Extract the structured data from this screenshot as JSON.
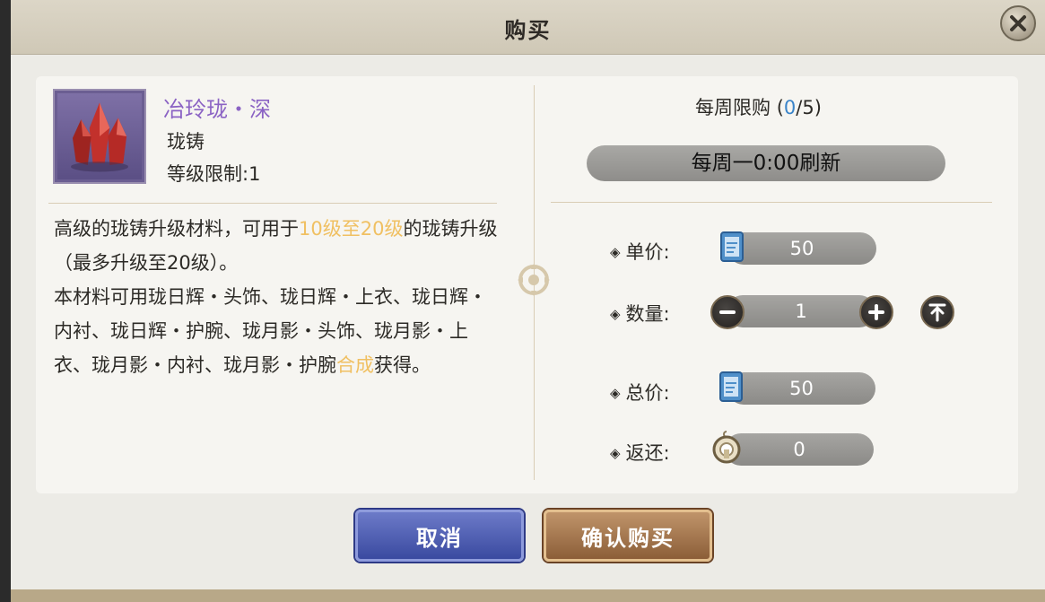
{
  "dialog": {
    "title": "购买"
  },
  "item": {
    "name": "冶玲珑・深",
    "type": "珑铸",
    "level_label": "等级限制:",
    "level_value": "1",
    "description": {
      "p1_a": "高级的珑铸升级材料，可用于",
      "p1_hl": "10级至20级",
      "p1_b": "的珑铸升级（最多升级至20级）。",
      "p2_a": "本材料可用珑日辉・头饰、珑日辉・上衣、珑日辉・内衬、珑日辉・护腕、珑月影・头饰、珑月影・上衣、珑月影・内衬、珑月影・护腕",
      "p2_hl": "合成",
      "p2_b": "获得。"
    }
  },
  "purchase": {
    "weekly_label": "每周限购",
    "weekly_open": "(",
    "weekly_count": "0",
    "weekly_limit": "/5)",
    "refresh": "每周一0:00刷新",
    "unit_price_label": "单价:",
    "unit_price": "50",
    "quantity_label": "数量:",
    "quantity": "1",
    "total_label": "总价:",
    "total": "50",
    "refund_label": "返还:",
    "refund": "0",
    "bullet": "◈"
  },
  "buttons": {
    "cancel": "取消",
    "confirm": "确认购买"
  },
  "icons": {
    "close": "close-icon",
    "minus": "minus-icon",
    "plus": "plus-icon",
    "max": "max-icon",
    "currency": "scroll-currency-icon",
    "refund_currency": "coin-icon",
    "item": "red-crystal-icon"
  },
  "colors": {
    "item_name": "#8b63c4",
    "highlight": "#f0c062",
    "weekly_count": "#3a84c9",
    "cancel_button": "#4a5ab0",
    "confirm_button": "#a07448"
  }
}
